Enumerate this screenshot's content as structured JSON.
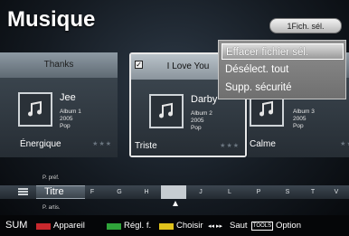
{
  "header": {
    "title": "Musique",
    "selected_count_label": "1Fich. sél."
  },
  "cards": [
    {
      "title": "Thanks",
      "artist": "Jee",
      "album": "Album 1",
      "year": "2005",
      "genre": "Pop",
      "mood": "Énergique",
      "stars": "★★★",
      "selected": false
    },
    {
      "title": "I Love You",
      "artist": "Darby",
      "album": "Album 2",
      "year": "2005",
      "genre": "Pop",
      "mood": "Triste",
      "stars": "★★★",
      "selected": true,
      "check": "✓"
    },
    {
      "title": "",
      "artist": "",
      "album": "Album 3",
      "year": "2005",
      "genre": "Pop",
      "mood": "Calme",
      "stars": "★★★",
      "selected": false
    }
  ],
  "context_menu": {
    "items": [
      "Effacer fichier sél.",
      "Désélect. tout",
      "Supp. sécurité"
    ],
    "highlighted_index": 0
  },
  "sort_bar": {
    "prev_label": "P. préf.",
    "current": "Titre",
    "next_label": "P. artis.",
    "letters": [
      "F",
      "G",
      "H",
      "",
      "J",
      "L",
      "P",
      "S",
      "T",
      "V"
    ],
    "active_letter_index": 3
  },
  "footer": {
    "sum": "SUM",
    "appareil": "Appareil",
    "regl": "Régl. f.",
    "choisir": "Choisir",
    "saut_arrows": "◂◂ ▸▸",
    "saut": "Saut",
    "tools": "TOOLS",
    "option": "Option"
  },
  "colors": {
    "key_red": "#c8282d",
    "key_green": "#2fa43a",
    "key_yellow": "#e0c21c",
    "key_blue": "#2e5fc4"
  }
}
